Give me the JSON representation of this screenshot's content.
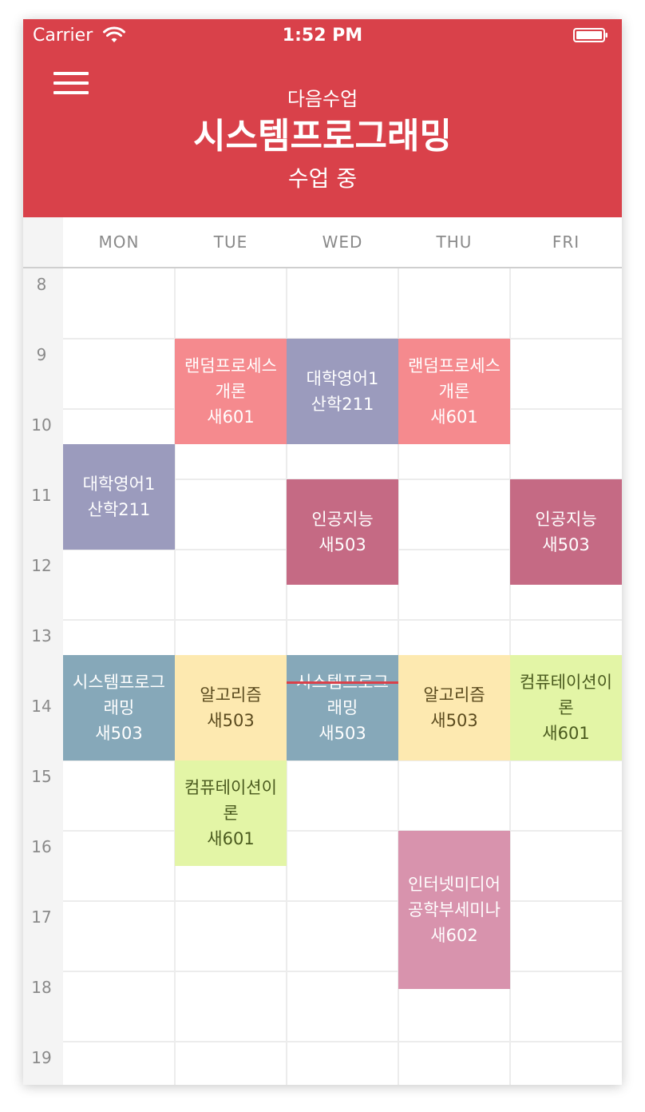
{
  "status_bar": {
    "carrier": "Carrier",
    "time": "1:52 PM"
  },
  "header": {
    "next_label": "다음수업",
    "course_title": "시스템프로그래밍",
    "course_status": "수업 중"
  },
  "days": [
    "MON",
    "TUE",
    "WED",
    "THU",
    "FRI"
  ],
  "hours": [
    "8",
    "9",
    "10",
    "11",
    "12",
    "13",
    "14",
    "15",
    "16",
    "17",
    "18",
    "19"
  ],
  "colors": {
    "header": "#d9414a",
    "random_process": "#f58a8e",
    "english": "#9b9bbd",
    "ai": "#c56a84",
    "system_programming": "#86a8b9",
    "algorithm": "#fde9b0",
    "computation": "#e3f5a6",
    "internet_media": "#d893ad"
  },
  "classes": [
    {
      "day": "TUE",
      "name": "랜덤프로세스\n개론",
      "room": "새601",
      "start": 9.0,
      "end": 10.5,
      "color": "#f58a8e",
      "text_color": "#ffffff"
    },
    {
      "day": "THU",
      "name": "랜덤프로세스\n개론",
      "room": "새601",
      "start": 9.0,
      "end": 10.5,
      "color": "#f58a8e",
      "text_color": "#ffffff"
    },
    {
      "day": "WED",
      "name": "대학영어1",
      "room": "산학211",
      "start": 9.0,
      "end": 10.5,
      "color": "#9b9bbd",
      "text_color": "#ffffff"
    },
    {
      "day": "MON",
      "name": "대학영어1",
      "room": "산학211",
      "start": 10.5,
      "end": 12.0,
      "color": "#9b9bbd",
      "text_color": "#ffffff"
    },
    {
      "day": "WED",
      "name": "인공지능",
      "room": "새503",
      "start": 11.0,
      "end": 12.5,
      "color": "#c56a84",
      "text_color": "#ffffff"
    },
    {
      "day": "FRI",
      "name": "인공지능",
      "room": "새503",
      "start": 11.0,
      "end": 12.5,
      "color": "#c56a84",
      "text_color": "#ffffff"
    },
    {
      "day": "MON",
      "name": "시스템프로그\n래밍",
      "room": "새503",
      "start": 13.5,
      "end": 15.0,
      "color": "#86a8b9",
      "text_color": "#ffffff"
    },
    {
      "day": "WED",
      "name": "시스템프로그\n래밍",
      "room": "새503",
      "start": 13.5,
      "end": 15.0,
      "color": "#86a8b9",
      "text_color": "#ffffff"
    },
    {
      "day": "TUE",
      "name": "알고리즘",
      "room": "새503",
      "start": 13.5,
      "end": 15.0,
      "color": "#fde9b0",
      "text_color": "#5a4a1e"
    },
    {
      "day": "THU",
      "name": "알고리즘",
      "room": "새503",
      "start": 13.5,
      "end": 15.0,
      "color": "#fde9b0",
      "text_color": "#5a4a1e"
    },
    {
      "day": "FRI",
      "name": "컴퓨테이션이\n론",
      "room": "새601",
      "start": 13.5,
      "end": 15.0,
      "color": "#e3f5a6",
      "text_color": "#4a5a1e"
    },
    {
      "day": "TUE",
      "name": "컴퓨테이션이\n론",
      "room": "새601",
      "start": 15.0,
      "end": 16.5,
      "color": "#e3f5a6",
      "text_color": "#4a5a1e"
    },
    {
      "day": "THU",
      "name": "인터넷미디어\n공학부세미나",
      "room": "새602",
      "start": 16.0,
      "end": 18.25,
      "color": "#d893ad",
      "text_color": "#ffffff"
    }
  ],
  "current_time_marker": {
    "day": "WED",
    "time": 13.87,
    "color": "#d9414a"
  }
}
